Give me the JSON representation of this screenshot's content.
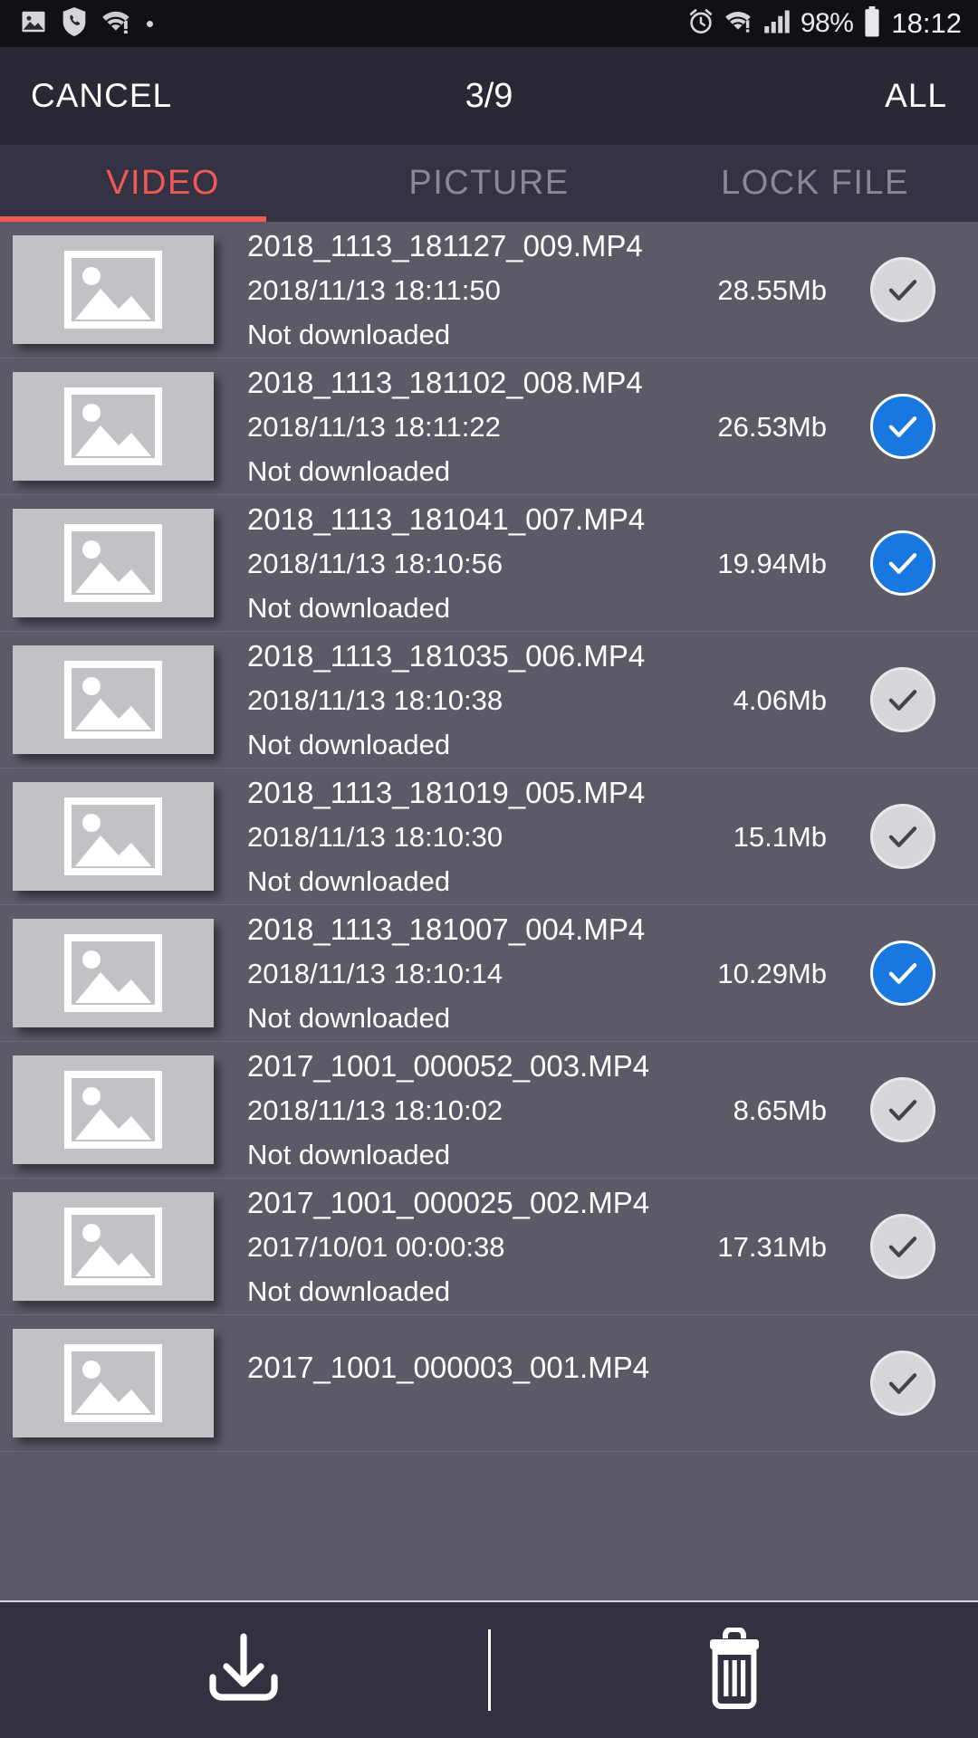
{
  "statusbar": {
    "left_icons": [
      "photo-icon",
      "phone-shield-icon",
      "wifi-alert-icon",
      "dot-icon"
    ],
    "right_icons": [
      "alarm-icon",
      "wifi-alert-icon",
      "signal-bars-icon",
      "battery-icon"
    ],
    "battery_percent": "98%",
    "clock": "18:12"
  },
  "actionbar": {
    "cancel_label": "CANCEL",
    "title": "3/9",
    "all_label": "ALL"
  },
  "tabs": [
    {
      "label": "VIDEO",
      "active": true
    },
    {
      "label": "PICTURE",
      "active": false
    },
    {
      "label": "LOCK FILE",
      "active": false
    }
  ],
  "colors": {
    "accent": "#f05a54",
    "selected_checkbox": "#1878e0",
    "unselected_checkbox": "#d6d6da",
    "statusbar_bg": "#111115",
    "actionbar_bg": "#2b2836",
    "tabbar_bg": "#353243",
    "list_bg": "#5d5a68",
    "bottombar_bg": "#33303f"
  },
  "files": [
    {
      "name": "2018_1113_181127_009.MP4",
      "date": "2018/11/13 18:11:50",
      "size": "28.55Mb",
      "status": "Not downloaded",
      "selected": false
    },
    {
      "name": "2018_1113_181102_008.MP4",
      "date": "2018/11/13 18:11:22",
      "size": "26.53Mb",
      "status": "Not downloaded",
      "selected": true
    },
    {
      "name": "2018_1113_181041_007.MP4",
      "date": "2018/11/13 18:10:56",
      "size": "19.94Mb",
      "status": "Not downloaded",
      "selected": true
    },
    {
      "name": "2018_1113_181035_006.MP4",
      "date": "2018/11/13 18:10:38",
      "size": "4.06Mb",
      "status": "Not downloaded",
      "selected": false
    },
    {
      "name": "2018_1113_181019_005.MP4",
      "date": "2018/11/13 18:10:30",
      "size": "15.1Mb",
      "status": "Not downloaded",
      "selected": false
    },
    {
      "name": "2018_1113_181007_004.MP4",
      "date": "2018/11/13 18:10:14",
      "size": "10.29Mb",
      "status": "Not downloaded",
      "selected": true
    },
    {
      "name": "2017_1001_000052_003.MP4",
      "date": "2018/11/13 18:10:02",
      "size": "8.65Mb",
      "status": "Not downloaded",
      "selected": false
    },
    {
      "name": "2017_1001_000025_002.MP4",
      "date": "2017/10/01 00:00:38",
      "size": "17.31Mb",
      "status": "Not downloaded",
      "selected": false
    },
    {
      "name": "2017_1001_000003_001.MP4",
      "date": "",
      "size": "",
      "status": "",
      "selected": false
    }
  ],
  "bottombar": {
    "download_icon": "download-icon",
    "delete_icon": "trash-icon"
  }
}
